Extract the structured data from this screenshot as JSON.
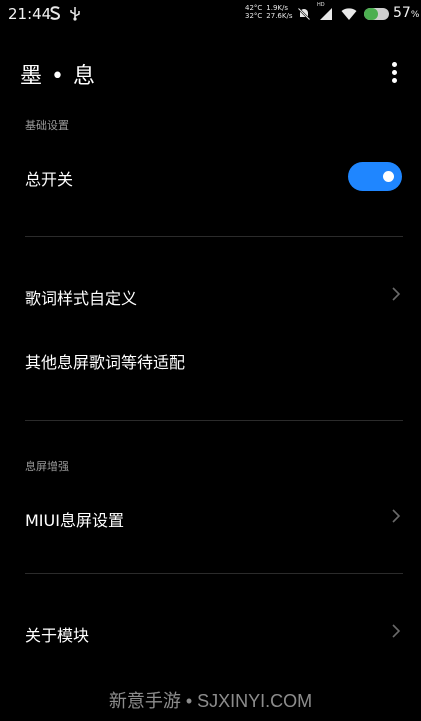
{
  "status_bar": {
    "time": "21:44",
    "left_icons": [
      "s-notification-icon",
      "usb-icon"
    ],
    "temp_top": "42°C",
    "temp_bottom": "32°C",
    "net_up": "1.9K/s",
    "net_down": "27.6K/s",
    "hd_label": "HD",
    "battery_percent": "57",
    "battery_percent_sign": "%",
    "battery_level": 0.57,
    "battery_color": "#4caf50"
  },
  "header": {
    "title": "墨 • 息",
    "menu_icon": "more-vertical-icon"
  },
  "sections": {
    "basic_header": "基础设置",
    "master_switch_label": "总开关",
    "master_switch_on": true,
    "lyric_style_label": "歌词样式自定义",
    "other_lyric_label": "其他息屏歌词等待适配",
    "aod_header": "息屏增强",
    "miui_aod_label": "MIUI息屏设置",
    "about_label": "关于模块"
  },
  "watermark": {
    "text": "新意手游 • SJXINYI.COM"
  },
  "colors": {
    "accent": "#1f86ff",
    "background": "#000000",
    "section_header": "#9a9a9a",
    "divider": "#2b2b2b"
  }
}
